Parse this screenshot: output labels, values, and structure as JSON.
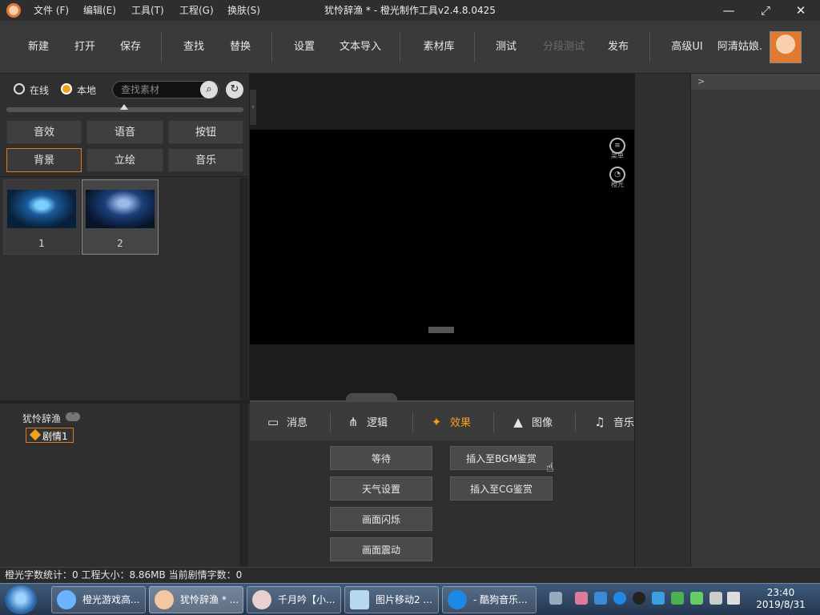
{
  "titlebar": {
    "menus": [
      "文件 (F)",
      "编辑(E)",
      "工具(T)",
      "工程(G)",
      "换肤(S)"
    ],
    "title": "犹怜辞渔 * - 橙光制作工具v2.4.8.0425",
    "minimize": "—",
    "maximize": "⤢",
    "close": "✕"
  },
  "toolbar": {
    "new": "新建",
    "open": "打开",
    "save": "保存",
    "find": "查找",
    "replace": "替换",
    "settings": "设置",
    "import_text": "文本导入",
    "assets": "素材库",
    "test": "测试",
    "segment_test": "分段测试",
    "publish": "发布",
    "advanced_ui": "高级UI",
    "username": "阿清姑娘."
  },
  "assets_panel": {
    "online": "在线",
    "local": "本地",
    "search_placeholder": "查找素材",
    "categories": [
      "音效",
      "语音",
      "按钮",
      "背景",
      "立绘",
      "音乐"
    ],
    "active_category": "背景",
    "thumbnails": [
      "1",
      "2"
    ]
  },
  "tree": {
    "project": "犹怜辞渔",
    "chapter": "剧情1"
  },
  "preview": {
    "menu_label": "菜单",
    "chengguang_label": "橙光"
  },
  "command_tabs": {
    "tabs": [
      "消息",
      "逻辑",
      "效果",
      "图像",
      "音乐"
    ],
    "active": "效果"
  },
  "commands": {
    "wait": "等待",
    "weather": "天气设置",
    "flash": "画面闪烁",
    "shake": "画面震动",
    "insert_bgm": "插入至BGM鉴赏",
    "insert_cg": "插入至CG鉴赏"
  },
  "right_panel": {
    "header": ">"
  },
  "statusbar": {
    "text": "橙光字数统计：0 工程大小：8.86MB 当前剧情字数：0"
  },
  "taskbar": {
    "tasks": [
      "橙光游戏高...",
      "犹怜辞渔 * ...",
      "千月吟【小...",
      "图片移动2 ...",
      "- 酷狗音乐..."
    ],
    "time": "23:40",
    "date": "2019/8/31"
  },
  "colors": {
    "accent": "#f3a21a",
    "active_border": "#e07a20"
  }
}
